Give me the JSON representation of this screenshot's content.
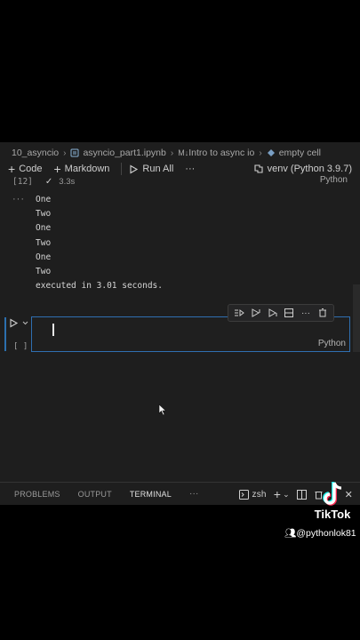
{
  "breadcrumb": {
    "folder": "10_asyncio",
    "file": "asyncio_part1.ipynb",
    "section_prefix": "M↓",
    "section": "Intro to async io",
    "cell": "empty cell"
  },
  "toolbar": {
    "code_label": "Code",
    "markdown_label": "Markdown",
    "run_all_label": "Run All",
    "more_label": "···",
    "kernel_label": "venv (Python 3.9.7)"
  },
  "prev_cell": {
    "exec_count": "[12]",
    "duration": "3.3s",
    "language": "Python",
    "output_dots": "···",
    "output_lines": [
      "One",
      "Two",
      "One",
      "Two",
      "One",
      "Two",
      "executed in 3.01 seconds."
    ]
  },
  "active_cell": {
    "exec_count": "[ ]",
    "language": "Python"
  },
  "panel": {
    "tabs": [
      "PROBLEMS",
      "OUTPUT",
      "TERMINAL"
    ],
    "more": "···",
    "shell": "zsh"
  },
  "watermark": {
    "brand": "TikTok",
    "user": "@pythonlok81"
  },
  "colors": {
    "editor_bg": "#1e1e1e",
    "focus_border": "#2f6fb1",
    "text": "#cccccc"
  }
}
